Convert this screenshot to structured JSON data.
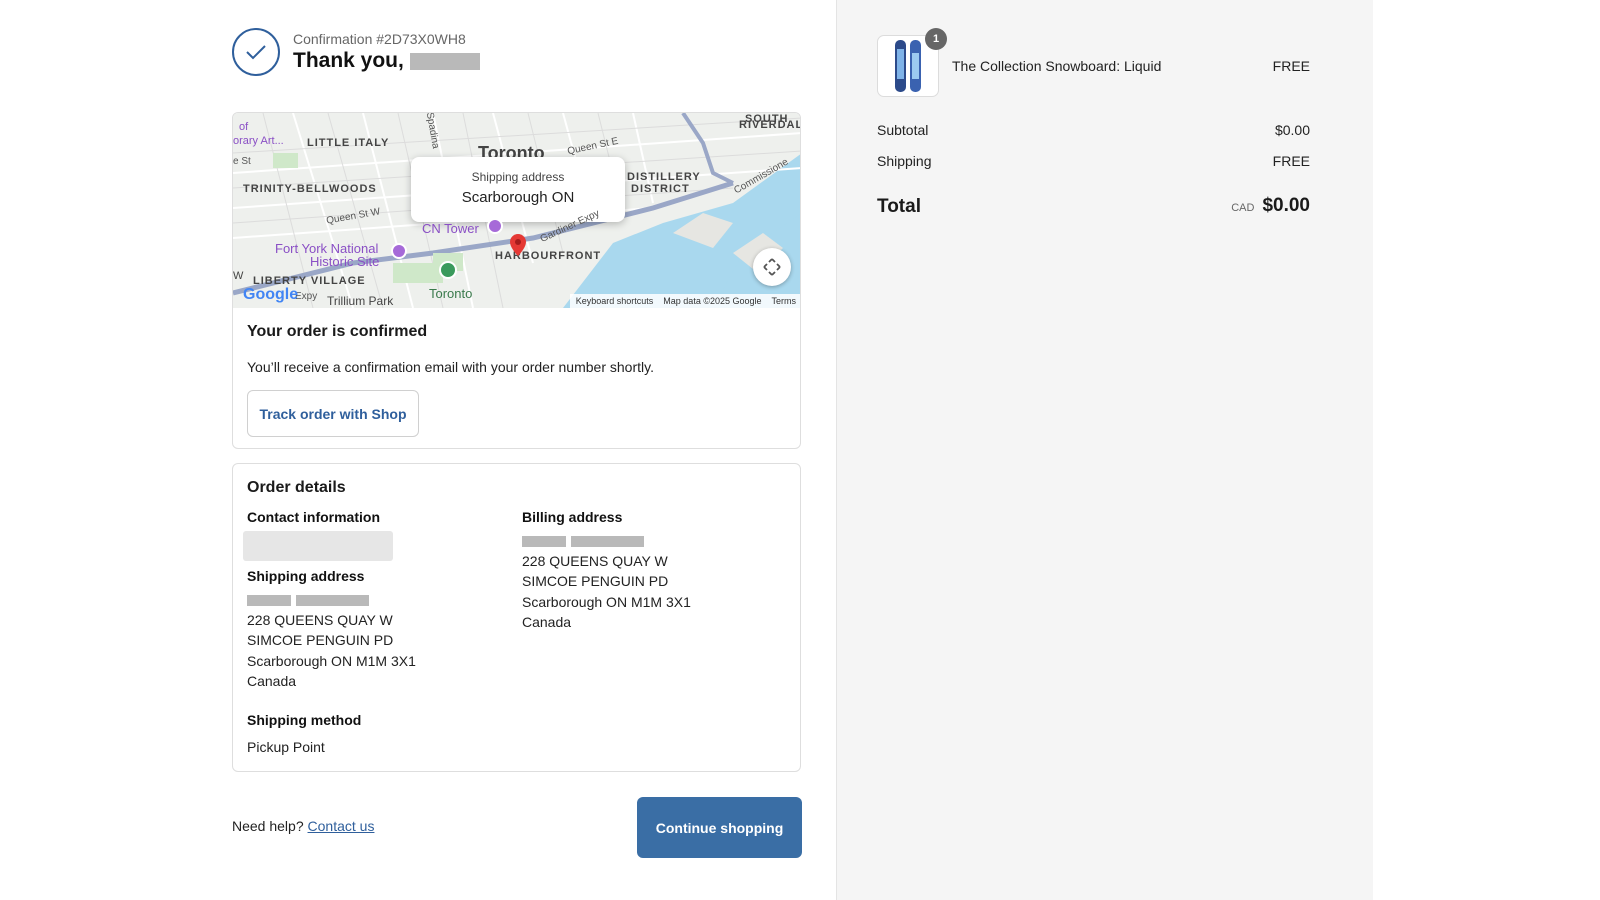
{
  "header": {
    "confirmation_number": "Confirmation #2D73X0WH8",
    "thank_you": "Thank you,"
  },
  "map": {
    "tooltip_title": "Shipping address",
    "tooltip_location": "Scarborough ON",
    "labels": {
      "little_italy": "LITTLE ITALY",
      "trinity": "TRINITY-BELLWOODS",
      "distillery": "DISTILLERY",
      "district": "DISTRICT",
      "south_riverdale_1": "SOUTH",
      "south_riverdale_2": "RIVERDALE",
      "harbourfront": "HARBOURFRONT",
      "liberty": "LIBERTY VILLAGE",
      "cn_tower": "CN Tower",
      "fort_york_1": "Fort York National",
      "fort_york_2": "Historic Site",
      "toronto": "Toronto",
      "toronto_big": "Toronto",
      "trillium": "Trillium Park",
      "queen_st_w": "Queen St W",
      "queen_st_e": "Queen St E",
      "commissioners": "Commissione",
      "gardiner": "Gardiner Expy",
      "spadina": "Spadina",
      "art": "orary Art...",
      "of": "of",
      "st": "e St",
      "expy": "Expy",
      "w": "W"
    },
    "google": "Google",
    "footer": {
      "shortcuts": "Keyboard shortcuts",
      "map_data": "Map data ©2025 Google",
      "terms": "Terms"
    }
  },
  "confirmation": {
    "title": "Your order is confirmed",
    "text": "You’ll receive a confirmation email with your order number shortly.",
    "track_button": "Track order with Shop"
  },
  "details": {
    "title": "Order details",
    "contact_heading": "Contact information",
    "shipping_heading": "Shipping address",
    "shipping_lines": [
      "228 QUEENS QUAY W",
      "SIMCOE PENGUIN PD",
      "Scarborough ON M1M 3X1",
      "Canada"
    ],
    "billing_heading": "Billing address",
    "billing_lines": [
      "228 QUEENS QUAY W",
      "SIMCOE PENGUIN PD",
      "Scarborough ON M1M 3X1",
      "Canada"
    ],
    "method_heading": "Shipping method",
    "method_value": "Pickup Point"
  },
  "footer": {
    "need_help": "Need help?",
    "contact_link": "Contact us",
    "continue_button": "Continue shopping"
  },
  "summary": {
    "quantity": "1",
    "product_name": "The Collection Snowboard: Liquid",
    "product_price": "FREE",
    "subtotal_label": "Subtotal",
    "subtotal_value": "$0.00",
    "shipping_label": "Shipping",
    "shipping_value": "FREE",
    "total_label": "Total",
    "currency": "CAD",
    "total_value": "$0.00"
  },
  "colors": {
    "accent": "#3a6ea5",
    "link": "#2f5f9c",
    "sidebar_bg": "#f5f5f5",
    "map_pin": "#e53935",
    "water": "#a9d8ee"
  }
}
